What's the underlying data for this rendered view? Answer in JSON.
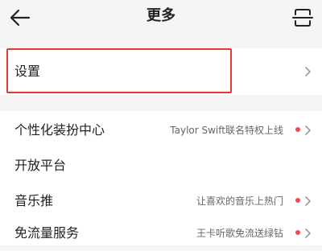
{
  "header": {
    "title": "更多",
    "back_icon": "back-arrow-icon",
    "scan_icon": "scan-icon"
  },
  "settings": {
    "label": "设置"
  },
  "list": {
    "items": [
      {
        "label": "个性化装扮中心",
        "sub": "Taylor Swift联名特权上线",
        "dot": true
      },
      {
        "label": "开放平台",
        "sub": "",
        "dot": false
      },
      {
        "label": "音乐推",
        "sub": "让喜欢的音乐上热门",
        "dot": true
      },
      {
        "label": "免流量服务",
        "sub": "王卡听歌免流送绿钻",
        "dot": true
      }
    ]
  },
  "colors": {
    "accent_red": "#e53935",
    "dot_red": "#f04a4a",
    "background": "#f5f5f5"
  }
}
